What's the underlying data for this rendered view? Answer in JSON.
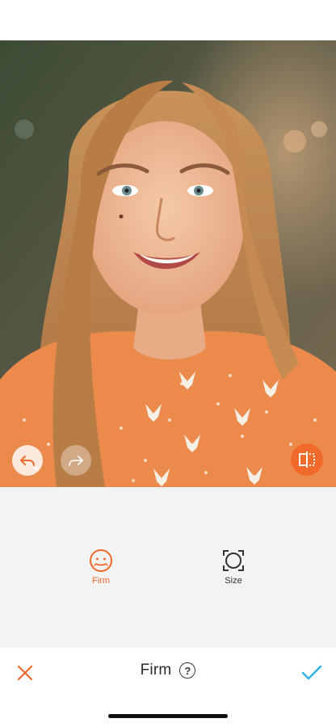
{
  "editor": {
    "title": "Firm",
    "help_icon": "question-circle-icon",
    "accent_color": "#f26a2b",
    "confirm_color": "#2ab4e8"
  },
  "tools": [
    {
      "label": "Firm",
      "icon": "face-smile-icon",
      "selected": true
    },
    {
      "label": "Size",
      "icon": "frame-circle-icon",
      "selected": false
    }
  ],
  "overlay_controls": {
    "undo_icon": "undo-icon",
    "redo_icon": "redo-icon",
    "compare_icon": "compare-split-icon"
  },
  "bottom_bar": {
    "cancel_icon": "close-icon",
    "confirm_icon": "checkmark-icon"
  }
}
